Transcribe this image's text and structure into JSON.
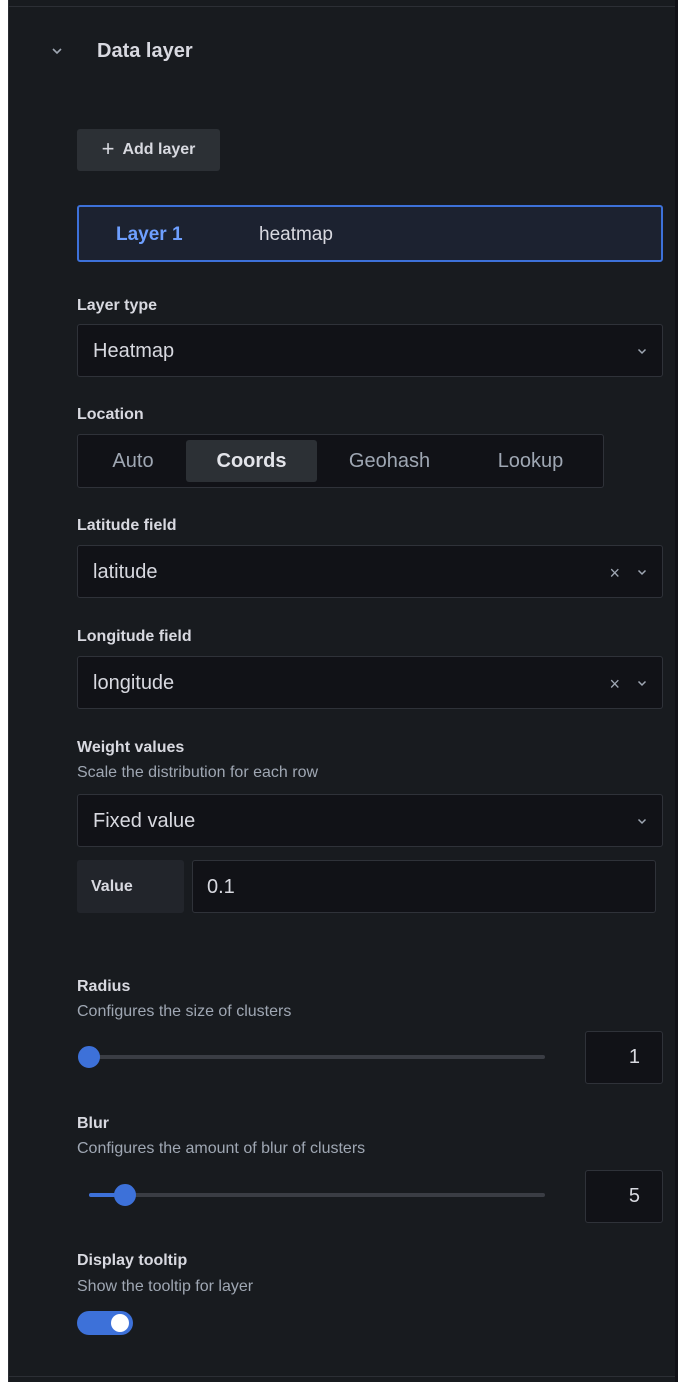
{
  "section": {
    "title": "Data layer",
    "chevron_icon": "chevron-down-icon"
  },
  "add_layer": {
    "icon": "plus-icon",
    "plus_glyph": "+",
    "label": "Add layer"
  },
  "layer": {
    "name": "Layer 1",
    "type": "heatmap"
  },
  "layer_type": {
    "label": "Layer type",
    "value": "Heatmap"
  },
  "location": {
    "label": "Location",
    "options": [
      "Auto",
      "Coords",
      "Geohash",
      "Lookup"
    ],
    "selected": "Coords"
  },
  "latitude": {
    "label": "Latitude field",
    "value": "latitude",
    "clear_glyph": "×"
  },
  "longitude": {
    "label": "Longitude field",
    "value": "longitude",
    "clear_glyph": "×"
  },
  "weight": {
    "label": "Weight values",
    "description": "Scale the distribution for each row",
    "mode": "Fixed value",
    "value_label": "Value",
    "value": "0.1"
  },
  "radius": {
    "label": "Radius",
    "description": "Configures the size of clusters",
    "value": "1",
    "fraction": 0
  },
  "blur": {
    "label": "Blur",
    "description": "Configures the amount of blur of clusters",
    "value": "5",
    "fraction": 0.08
  },
  "tooltip": {
    "label": "Display tooltip",
    "description": "Show the tooltip for layer",
    "enabled": true
  },
  "colors": {
    "accent": "#3d71d9",
    "panel_bg": "#181b1f",
    "input_bg": "#111217"
  }
}
